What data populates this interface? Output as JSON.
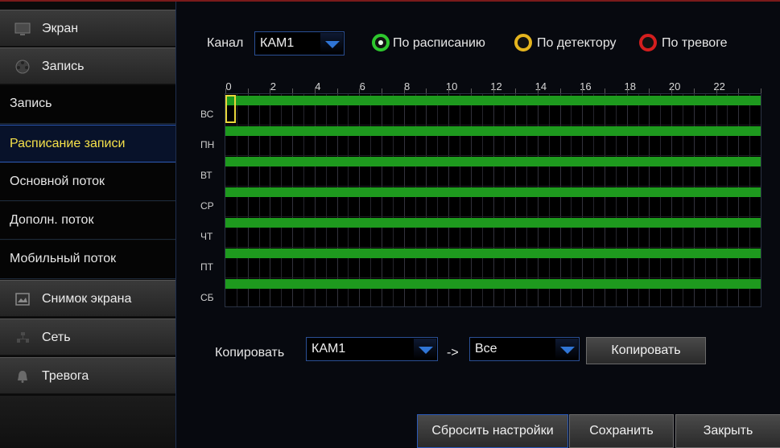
{
  "sidebar": {
    "screen_label": "Экран",
    "record_label": "Запись",
    "items": [
      {
        "label": "Запись"
      },
      {
        "label": "Расписание записи"
      },
      {
        "label": "Основной поток"
      },
      {
        "label": "Дополн. поток"
      },
      {
        "label": "Мобильный поток"
      }
    ],
    "screenshot_label": "Снимок экрана",
    "network_label": "Сеть",
    "alarm_label": "Тревога"
  },
  "channel": {
    "label": "Канал",
    "value": "КАМ1"
  },
  "modes": {
    "schedule": "По расписанию",
    "detector": "По детектору",
    "alarm": "По тревоге"
  },
  "schedule": {
    "hour_ticks": [
      "0",
      "2",
      "4",
      "6",
      "8",
      "10",
      "12",
      "14",
      "16",
      "18",
      "20",
      "22"
    ],
    "days": [
      "ВС",
      "ПН",
      "ВТ",
      "СР",
      "ЧТ",
      "ПТ",
      "СБ"
    ],
    "colors": {
      "schedule": "#1e9a1e",
      "detector": "#e4b41e",
      "alarm": "#d41e1e",
      "selection": "#e9d73b"
    }
  },
  "copy": {
    "label": "Копировать",
    "from_value": "КАМ1",
    "arrow": "->",
    "to_value": "Все",
    "button": "Копировать"
  },
  "footer": {
    "reset": "Сбросить настройки",
    "save": "Сохранить",
    "close": "Закрыть"
  }
}
